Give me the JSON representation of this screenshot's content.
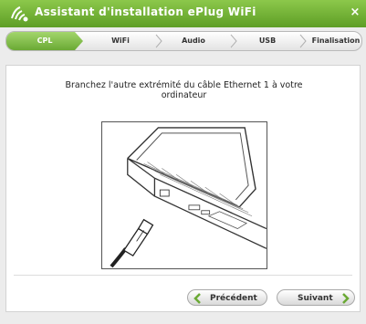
{
  "window": {
    "title": "Assistant d'installation ePlug WiFi",
    "close_label": "×"
  },
  "steps": [
    {
      "label": "CPL",
      "active": true
    },
    {
      "label": "WiFi",
      "active": false
    },
    {
      "label": "Audio",
      "active": false
    },
    {
      "label": "USB",
      "active": false
    },
    {
      "label": "Finalisation",
      "active": false
    }
  ],
  "main": {
    "instruction": "Branchez l'autre extrémité du câble Ethernet 1 à votre ordinateur"
  },
  "buttons": {
    "previous": "Précédent",
    "next": "Suivant"
  },
  "colors": {
    "accent_green": "#6aa934",
    "title_green": "#5e9e25"
  }
}
